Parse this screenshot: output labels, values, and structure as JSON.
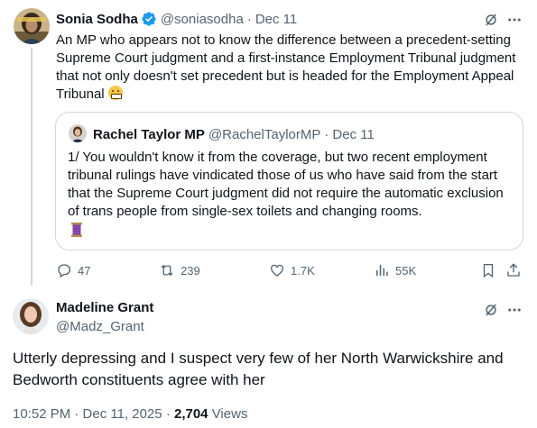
{
  "tweet": {
    "author_name": "Sonia Sodha",
    "author_handle": "@soniasodha",
    "separator": "·",
    "time": "Dec 11",
    "text": "An MP who appears not to know the difference between a precedent-setting Supreme Court judgment and a first-instance Employment Tribunal judgment that not only doesn't set precedent but is headed for the Employment Appeal Tribunal",
    "emoji_icon": "grimacing-face-icon",
    "verified_color": "#1d9bf0",
    "quote": {
      "author_name": "Rachel Taylor MP",
      "author_handle": "@RachelTaylorMP",
      "separator": "·",
      "time": "Dec 11",
      "text": "1/ You wouldn't know it from the coverage, but two recent employment tribunal rulings have vindicated those of us who have said from the start that the Supreme Court judgment did not require the automatic exclusion of trans people from single-sex toilets and changing rooms.",
      "emoji_icon": "spool-of-thread-icon"
    },
    "actions": {
      "replies": "47",
      "reposts": "239",
      "likes": "1.7K",
      "views": "55K"
    }
  },
  "reply": {
    "author_name": "Madeline Grant",
    "author_handle": "@Madz_Grant",
    "text": "Utterly depressing and I suspect very few of her North Warwickshire and Bedworth constituents agree with her",
    "timestamp": "10:52 PM · Dec 11, 2025 · ",
    "view_count": "2,704",
    "views_label": " Views"
  }
}
